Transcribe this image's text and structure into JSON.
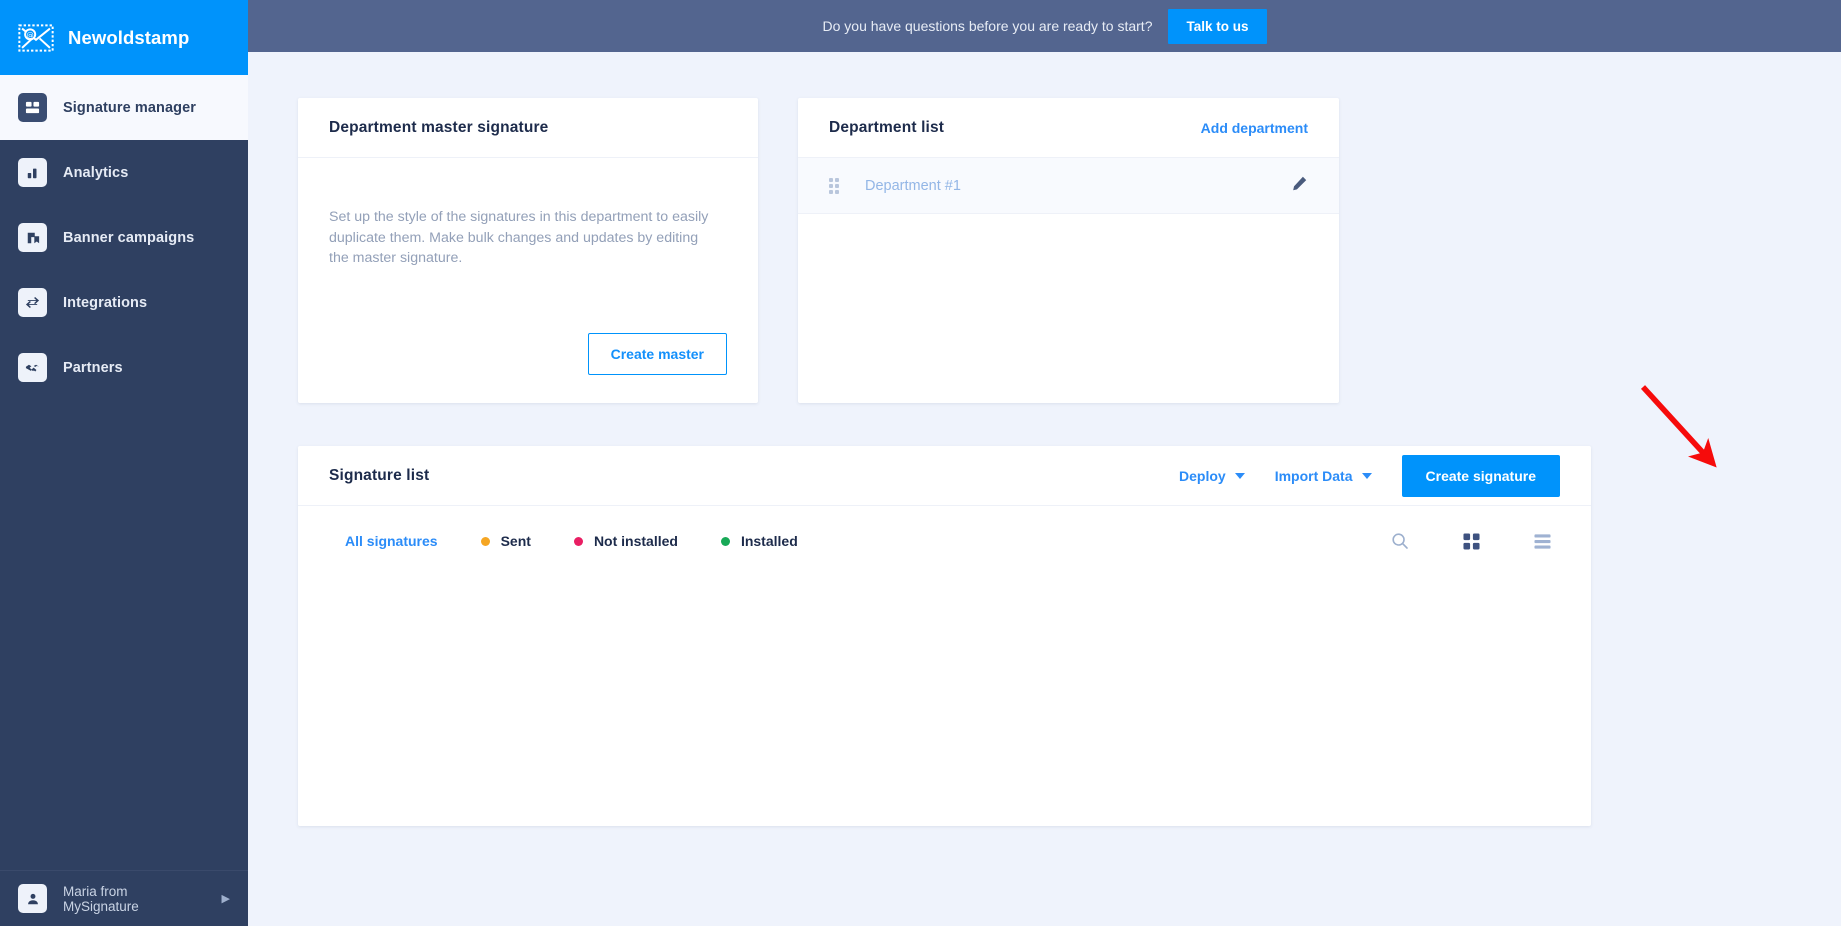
{
  "brand": {
    "name": "Newoldstamp",
    "logo_icon": "stamp-envelope-icon"
  },
  "sidebar": {
    "items": [
      {
        "label": "Signature manager",
        "icon": "signature-card-icon",
        "active": true
      },
      {
        "label": "Analytics",
        "icon": "bar-chart-icon",
        "active": false
      },
      {
        "label": "Banner campaigns",
        "icon": "banner-bookmark-icon",
        "active": false
      },
      {
        "label": "Integrations",
        "icon": "exchange-arrows-icon",
        "active": false
      },
      {
        "label": "Partners",
        "icon": "handshake-icon",
        "active": false
      }
    ],
    "footer": {
      "user": "Maria from MySignature",
      "icon": "user-avatar-icon",
      "caret": "▶"
    }
  },
  "topbar": {
    "message": "Do you have questions before you are ready to start?",
    "cta_label": "Talk to us"
  },
  "master_card": {
    "title": "Department master signature",
    "description": "Set up the style of the signatures in this department to easily duplicate them. Make bulk changes and updates by editing the master signature.",
    "button_label": "Create master"
  },
  "department_card": {
    "title": "Department list",
    "add_label": "Add department",
    "rows": [
      {
        "name": "Department #1",
        "drag_icon": "drag-handle-icon",
        "edit_icon": "pencil-icon"
      }
    ]
  },
  "signature_list": {
    "title": "Signature list",
    "deploy_label": "Deploy",
    "import_label": "Import Data",
    "create_label": "Create signature",
    "filters": [
      {
        "label": "All signatures",
        "color": null,
        "active": true
      },
      {
        "label": "Sent",
        "color": "#f5a623",
        "active": false
      },
      {
        "label": "Not installed",
        "color": "#e91e63",
        "active": false
      },
      {
        "label": "Installed",
        "color": "#18a957",
        "active": false
      }
    ],
    "search_icon": "search-icon",
    "grid_view_icon": "grid-view-icon",
    "list_view_icon": "list-view-icon"
  },
  "annotation": {
    "arrow_color": "#f60b0b",
    "target": "create-signature-button"
  },
  "colors": {
    "brand_blue": "#0093fb",
    "sidebar_navy": "#2f4061",
    "topbar_slate": "#53658f",
    "page_bg": "#eff3fc",
    "link_blue": "#2b8cf8"
  }
}
